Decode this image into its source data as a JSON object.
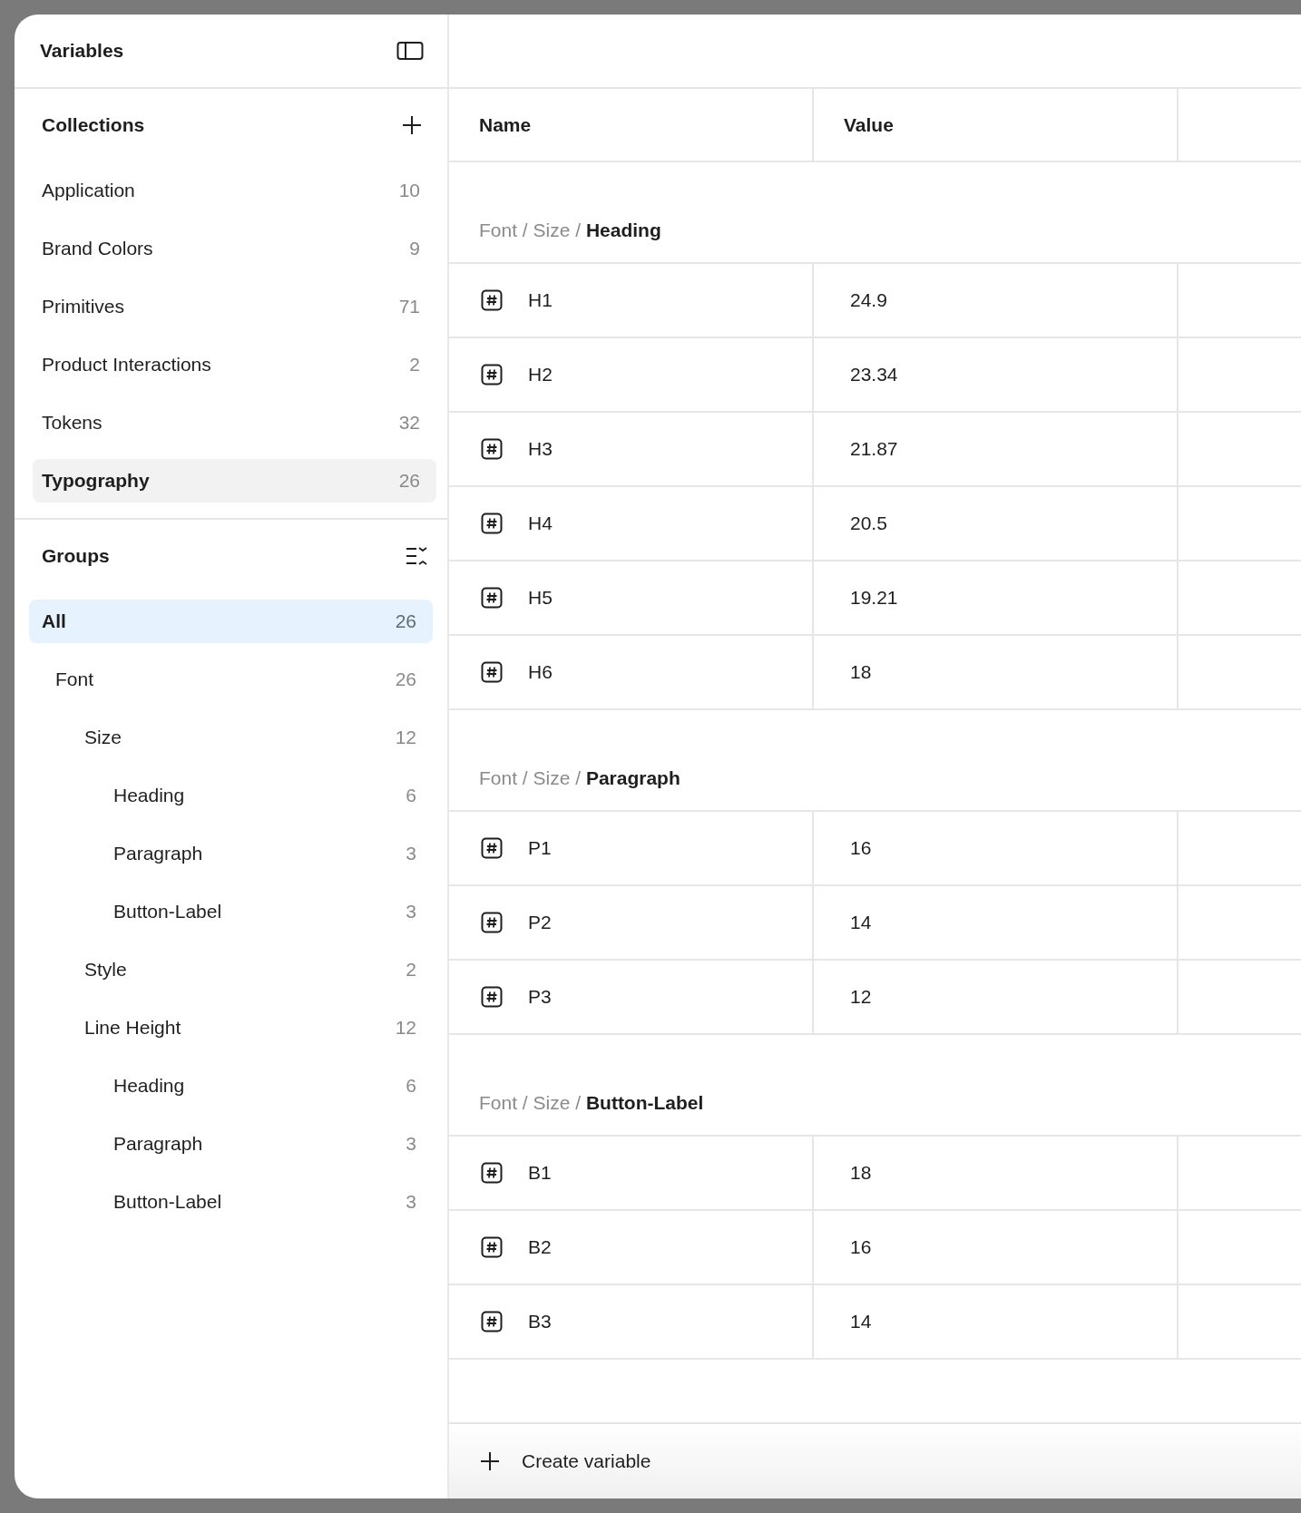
{
  "sidebar": {
    "title": "Variables",
    "collections": {
      "heading": "Collections",
      "items": [
        {
          "label": "Application",
          "count": "10",
          "selected": false
        },
        {
          "label": "Brand Colors",
          "count": "9",
          "selected": false
        },
        {
          "label": "Primitives",
          "count": "71",
          "selected": false
        },
        {
          "label": "Product Interactions",
          "count": "2",
          "selected": false
        },
        {
          "label": "Tokens",
          "count": "32",
          "selected": false
        },
        {
          "label": "Typography",
          "count": "26",
          "selected": true
        }
      ]
    },
    "groups": {
      "heading": "Groups",
      "items": [
        {
          "label": "All",
          "count": "26",
          "selected": true,
          "children": [
            {
              "label": "Font",
              "count": "26",
              "selected": false,
              "children": [
                {
                  "label": "Size",
                  "count": "12",
                  "selected": false,
                  "children": [
                    {
                      "label": "Heading",
                      "count": "6",
                      "selected": false
                    },
                    {
                      "label": "Paragraph",
                      "count": "3",
                      "selected": false
                    },
                    {
                      "label": "Button-Label",
                      "count": "3",
                      "selected": false
                    }
                  ]
                },
                {
                  "label": "Style",
                  "count": "2",
                  "selected": false
                },
                {
                  "label": "Line Height",
                  "count": "12",
                  "selected": false,
                  "children": [
                    {
                      "label": "Heading",
                      "count": "6",
                      "selected": false
                    },
                    {
                      "label": "Paragraph",
                      "count": "3",
                      "selected": false
                    },
                    {
                      "label": "Button-Label",
                      "count": "3",
                      "selected": false
                    }
                  ]
                }
              ]
            }
          ]
        }
      ]
    }
  },
  "table": {
    "columns": [
      "Name",
      "Value"
    ],
    "sections": [
      {
        "prefix": "Font / Size /",
        "group": "Heading",
        "rows": [
          {
            "name": "H1",
            "value": "24.9"
          },
          {
            "name": "H2",
            "value": "23.34"
          },
          {
            "name": "H3",
            "value": "21.87"
          },
          {
            "name": "H4",
            "value": "20.5"
          },
          {
            "name": "H5",
            "value": "19.21"
          },
          {
            "name": "H6",
            "value": "18"
          }
        ]
      },
      {
        "prefix": "Font / Size /",
        "group": "Paragraph",
        "rows": [
          {
            "name": "P1",
            "value": "16"
          },
          {
            "name": "P2",
            "value": "14"
          },
          {
            "name": "P3",
            "value": "12"
          }
        ]
      },
      {
        "prefix": "Font / Size /",
        "group": "Button-Label",
        "rows": [
          {
            "name": "B1",
            "value": "18"
          },
          {
            "name": "B2",
            "value": "16"
          },
          {
            "name": "B3",
            "value": "14"
          }
        ]
      }
    ],
    "create_button": "Create variable"
  }
}
